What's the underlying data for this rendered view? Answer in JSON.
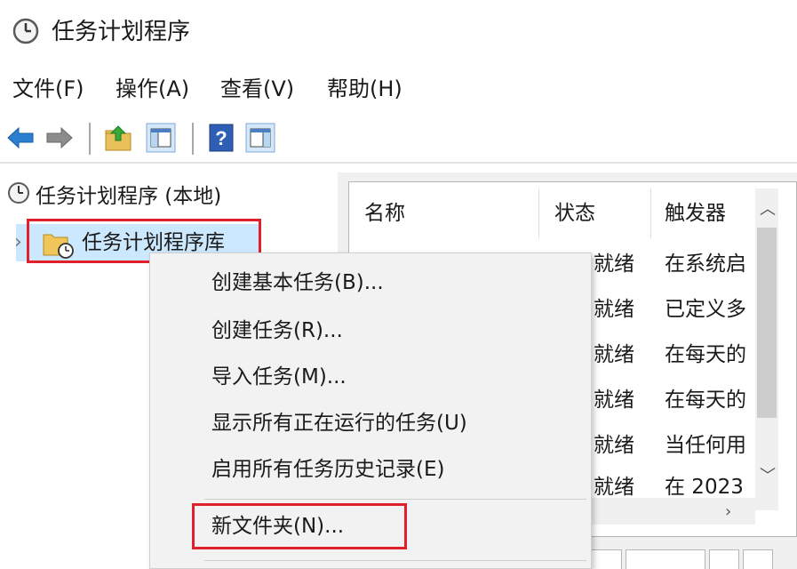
{
  "window": {
    "title": "任务计划程序",
    "icon": "clock-icon"
  },
  "menubar": {
    "items": [
      {
        "label": "文件(F)"
      },
      {
        "label": "操作(A)"
      },
      {
        "label": "查看(V)"
      },
      {
        "label": "帮助(H)"
      }
    ]
  },
  "toolbar": {
    "buttons": [
      {
        "icon": "back-arrow-icon"
      },
      {
        "icon": "forward-arrow-icon"
      },
      {
        "icon": "up-folder-icon"
      },
      {
        "icon": "show-hide-console-tree-icon"
      },
      {
        "icon": "help-icon"
      },
      {
        "icon": "show-hide-action-pane-icon"
      }
    ]
  },
  "tree": {
    "root_label": "任务计划程序 (本地)",
    "library_label": "任务计划程序库"
  },
  "task_list": {
    "columns": [
      "名称",
      "状态",
      "触发器"
    ],
    "rows": [
      {
        "status": "就绪",
        "trigger": "在系统启"
      },
      {
        "status": "就绪",
        "trigger": "已定义多"
      },
      {
        "status": "就绪",
        "trigger": "在每天的"
      },
      {
        "status": "就绪",
        "trigger": "在每天的"
      },
      {
        "status": "就绪",
        "trigger": "当任何用"
      },
      {
        "status": "就绪",
        "trigger": "在 2023"
      }
    ]
  },
  "context_menu": {
    "items": [
      {
        "label": "创建基本任务(B)..."
      },
      {
        "label": "创建任务(R)..."
      },
      {
        "label": "导入任务(M)..."
      },
      {
        "label": "显示所有正在运行的任务(U)"
      },
      {
        "label": "启用所有任务历史记录(E)"
      },
      {
        "label": "新文件夹(N)..."
      }
    ]
  },
  "colors": {
    "highlight_border": "#e0202a",
    "selection": "#cce8ff"
  }
}
